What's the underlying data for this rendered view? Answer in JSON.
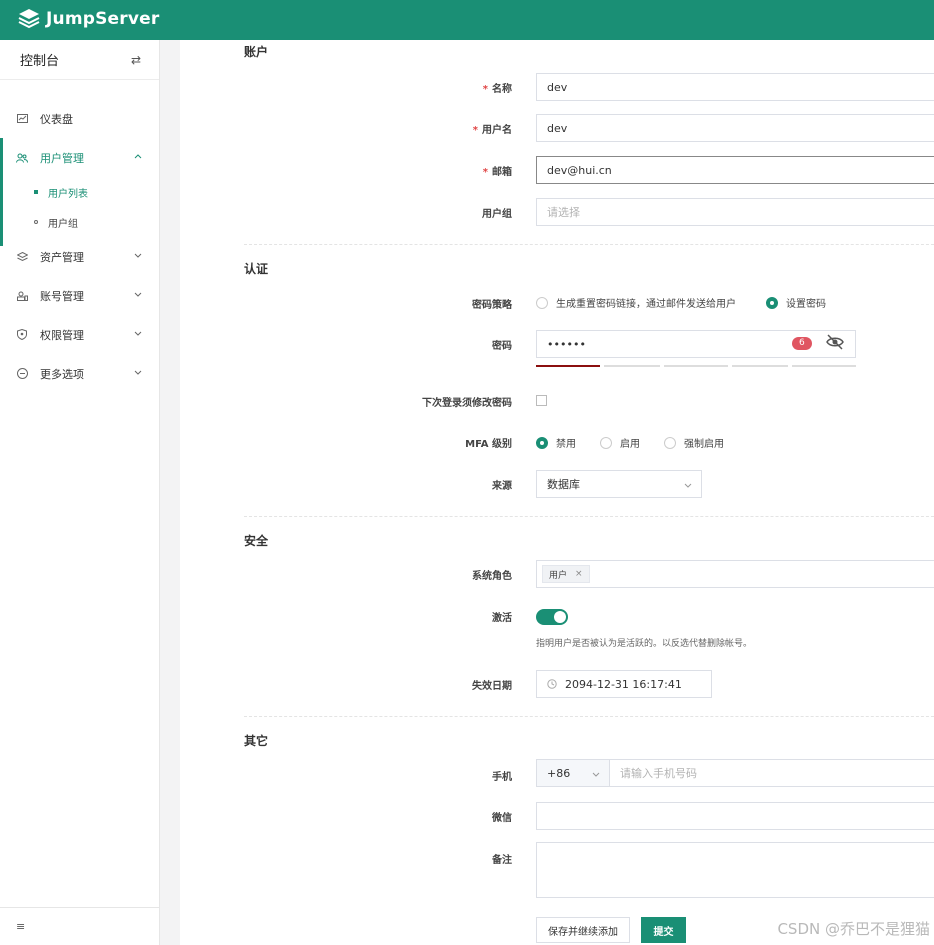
{
  "app": {
    "logo_text": "JumpServer"
  },
  "sidebar": {
    "title": "控制台",
    "switch_icon": "⇄",
    "items": [
      {
        "label": "仪表盘"
      },
      {
        "label": "用户管理"
      },
      {
        "label": "资产管理"
      },
      {
        "label": "账号管理"
      },
      {
        "label": "权限管理"
      },
      {
        "label": "更多选项"
      }
    ],
    "sub_items": [
      {
        "label": "用户列表"
      },
      {
        "label": "用户组"
      }
    ],
    "footer_icon": "≡"
  },
  "form": {
    "sections": {
      "account": "账户",
      "auth": "认证",
      "security": "安全",
      "other": "其它"
    },
    "name": {
      "label": "名称",
      "value": "dev"
    },
    "username": {
      "label": "用户名",
      "value": "dev"
    },
    "email": {
      "label": "邮箱",
      "value": "dev@hui.cn"
    },
    "groups": {
      "label": "用户组",
      "placeholder": "请选择"
    },
    "password_strategy": {
      "label": "密码策略",
      "option_email": "生成重置密码链接，通过邮件发送给用户",
      "option_set": "设置密码"
    },
    "password": {
      "label": "密码",
      "value": "••••••",
      "length_badge": "6"
    },
    "need_update": {
      "label": "下次登录须修改密码"
    },
    "mfa": {
      "label": "MFA 级别",
      "option_disable": "禁用",
      "option_enable": "启用",
      "option_force": "强制启用"
    },
    "source": {
      "label": "来源",
      "value": "数据库"
    },
    "role": {
      "label": "系统角色",
      "tag": "用户",
      "tag_close": "×"
    },
    "active": {
      "label": "激活",
      "help": "指明用户是否被认为是活跃的。以反选代替删除帐号。"
    },
    "expired": {
      "label": "失效日期",
      "value": "2094-12-31 16:17:41"
    },
    "phone": {
      "label": "手机",
      "code": "+86",
      "placeholder": "请输入手机号码"
    },
    "wechat": {
      "label": "微信"
    },
    "comment": {
      "label": "备注"
    },
    "buttons": {
      "save_continue": "保存并继续添加",
      "submit": "提交"
    }
  },
  "watermark": "CSDN @乔巴不是狸猫",
  "colors": {
    "brand": "#1a8f75",
    "badge": "#e05561",
    "required": "#e04545"
  }
}
